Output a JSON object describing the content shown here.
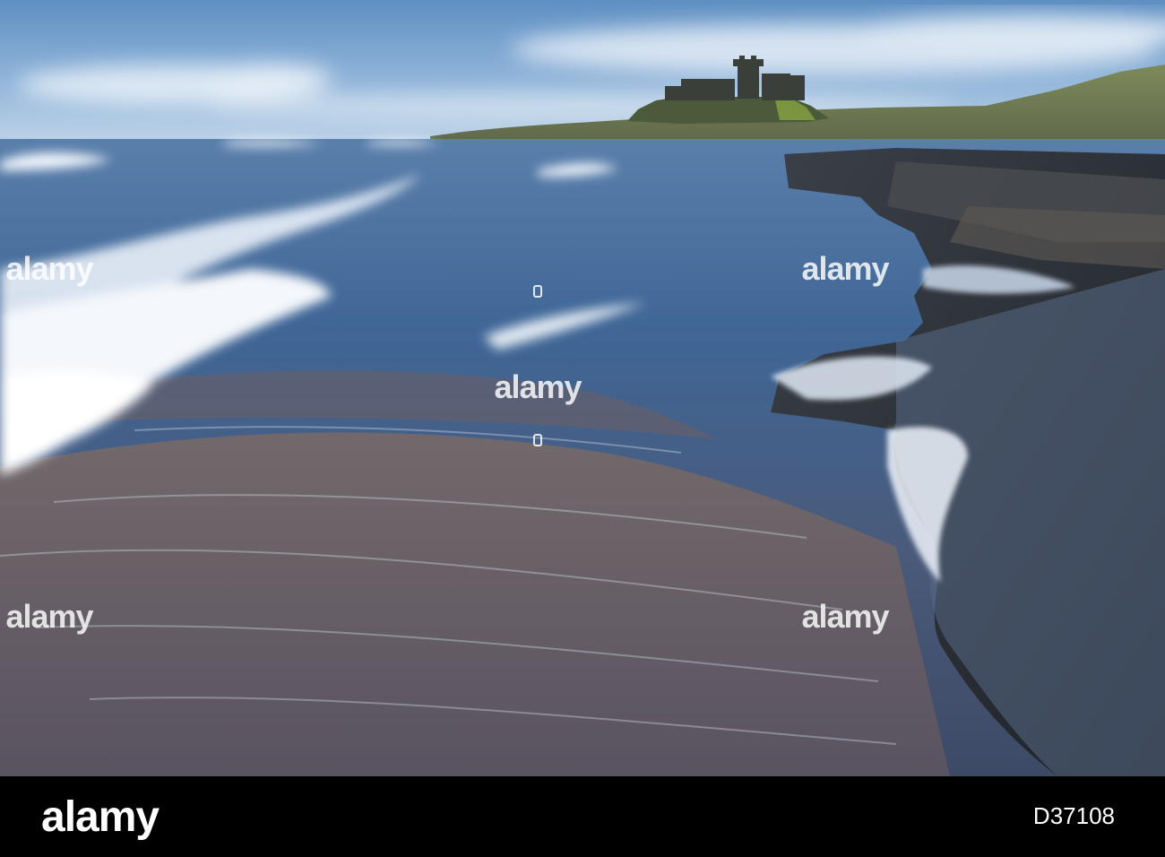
{
  "watermark": {
    "text": "alamy"
  },
  "footer": {
    "logo": "alamy",
    "image_id": "D37108"
  },
  "colors": {
    "sky": "#6f9cc9",
    "sea": "#3f6695",
    "foam": "#eef3fa",
    "sand": "#6e625f",
    "rock": "#252930",
    "bar": "#000000"
  }
}
